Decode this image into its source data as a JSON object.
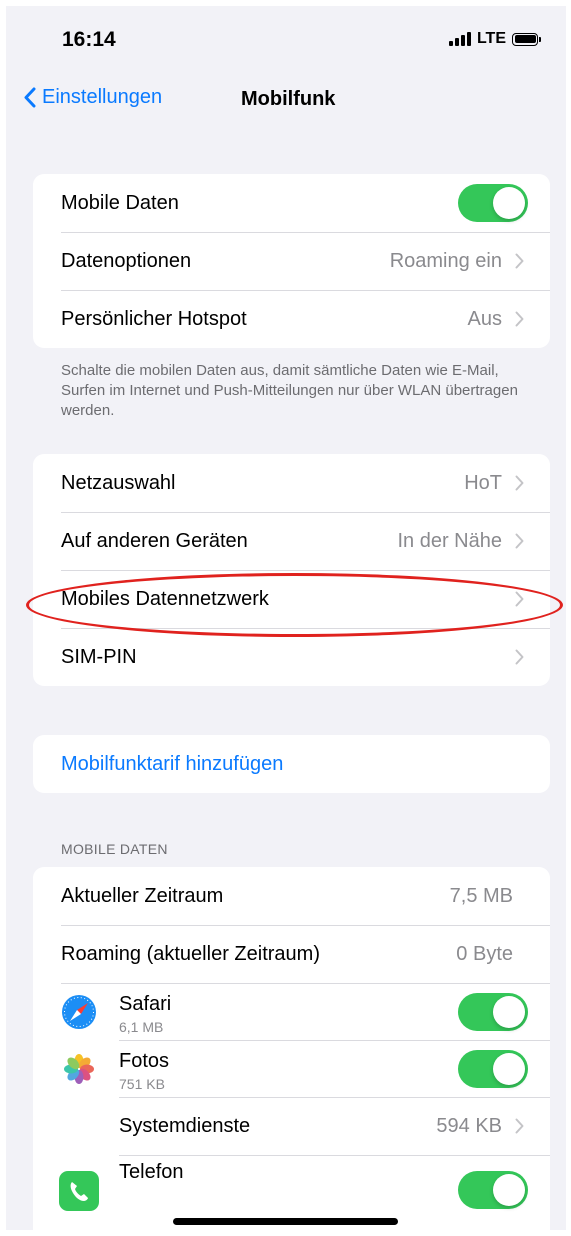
{
  "status_bar": {
    "time": "16:14",
    "network": "LTE"
  },
  "navbar": {
    "back_label": "Einstellungen",
    "title": "Mobilfunk"
  },
  "group1": {
    "mobile_data": {
      "label": "Mobile Daten",
      "toggle": true
    },
    "data_options": {
      "label": "Datenoptionen",
      "value": "Roaming ein"
    },
    "hotspot": {
      "label": "Persönlicher Hotspot",
      "value": "Aus"
    }
  },
  "group1_footer": "Schalte die mobilen Daten aus, damit sämtliche Daten wie E-Mail, Surfen im Internet und Push-Mitteilungen nur über WLAN übertragen werden.",
  "group2": {
    "network_selection": {
      "label": "Netzauswahl",
      "value": "HoT"
    },
    "other_devices": {
      "label": "Auf anderen Geräten",
      "value": "In der Nähe"
    },
    "mobile_data_network": {
      "label": "Mobiles Datennetzwerk"
    },
    "sim_pin": {
      "label": "SIM-PIN"
    }
  },
  "add_plan": {
    "label": "Mobilfunktarif hinzufügen"
  },
  "usage_section": {
    "header": "MOBILE DATEN",
    "current_period": {
      "label": "Aktueller Zeitraum",
      "value": "7,5 MB"
    },
    "roaming_period": {
      "label": "Roaming (aktueller Zeitraum)",
      "value": "0 Byte"
    },
    "apps": [
      {
        "name": "Safari",
        "usage": "6,1 MB",
        "icon": "safari-icon",
        "toggle": true
      },
      {
        "name": "Fotos",
        "usage": "751 KB",
        "icon": "photos-icon",
        "toggle": true
      }
    ],
    "system_services": {
      "label": "Systemdienste",
      "value": "594 KB"
    },
    "phone": {
      "name": "Telefon",
      "icon": "phone-icon",
      "toggle": true
    }
  },
  "colors": {
    "accent": "#0a7aff",
    "toggle_on": "#34c759",
    "highlight": "#e0221e"
  }
}
